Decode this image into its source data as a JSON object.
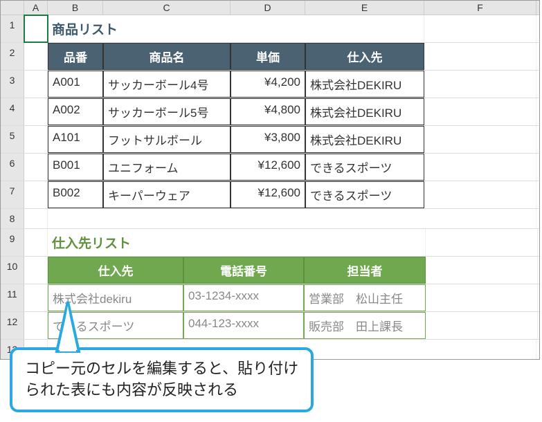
{
  "columns": [
    "A",
    "B",
    "C",
    "D",
    "E",
    "F"
  ],
  "rows": [
    1,
    2,
    3,
    4,
    5,
    6,
    7,
    8,
    9,
    10,
    11,
    12,
    13
  ],
  "selectedCell": "A1",
  "table1": {
    "title": "商品リスト",
    "headers": [
      "品番",
      "商品名",
      "単価",
      "仕入先"
    ],
    "rows": [
      {
        "code": "A001",
        "name": "サッカーボール4号",
        "price": "¥4,200",
        "supplier": "株式会社DEKIRU"
      },
      {
        "code": "A002",
        "name": "サッカーボール5号",
        "price": "¥4,800",
        "supplier": "株式会社DEKIRU"
      },
      {
        "code": "A101",
        "name": "フットサルボール",
        "price": "¥3,800",
        "supplier": "株式会社DEKIRU"
      },
      {
        "code": "B001",
        "name": "ユニフォーム",
        "price": "¥12,600",
        "supplier": "できるスポーツ"
      },
      {
        "code": "B002",
        "name": "キーパーウェア",
        "price": "¥12,600",
        "supplier": "できるスポーツ"
      }
    ]
  },
  "table2": {
    "title": "仕入先リスト",
    "headers": [
      "仕入先",
      "電話番号",
      "担当者"
    ],
    "rows": [
      {
        "supplier": "株式会社dekiru",
        "phone": "03-1234-xxxx",
        "contact": "営業部　松山主任"
      },
      {
        "supplier": "できるスポーツ",
        "phone": "044-123-xxxx",
        "contact": "販売部　田上課長"
      }
    ]
  },
  "callout": {
    "line1": "コピー元のセルを編集すると、貼り付け",
    "line2": "られた表にも内容が反映される"
  }
}
